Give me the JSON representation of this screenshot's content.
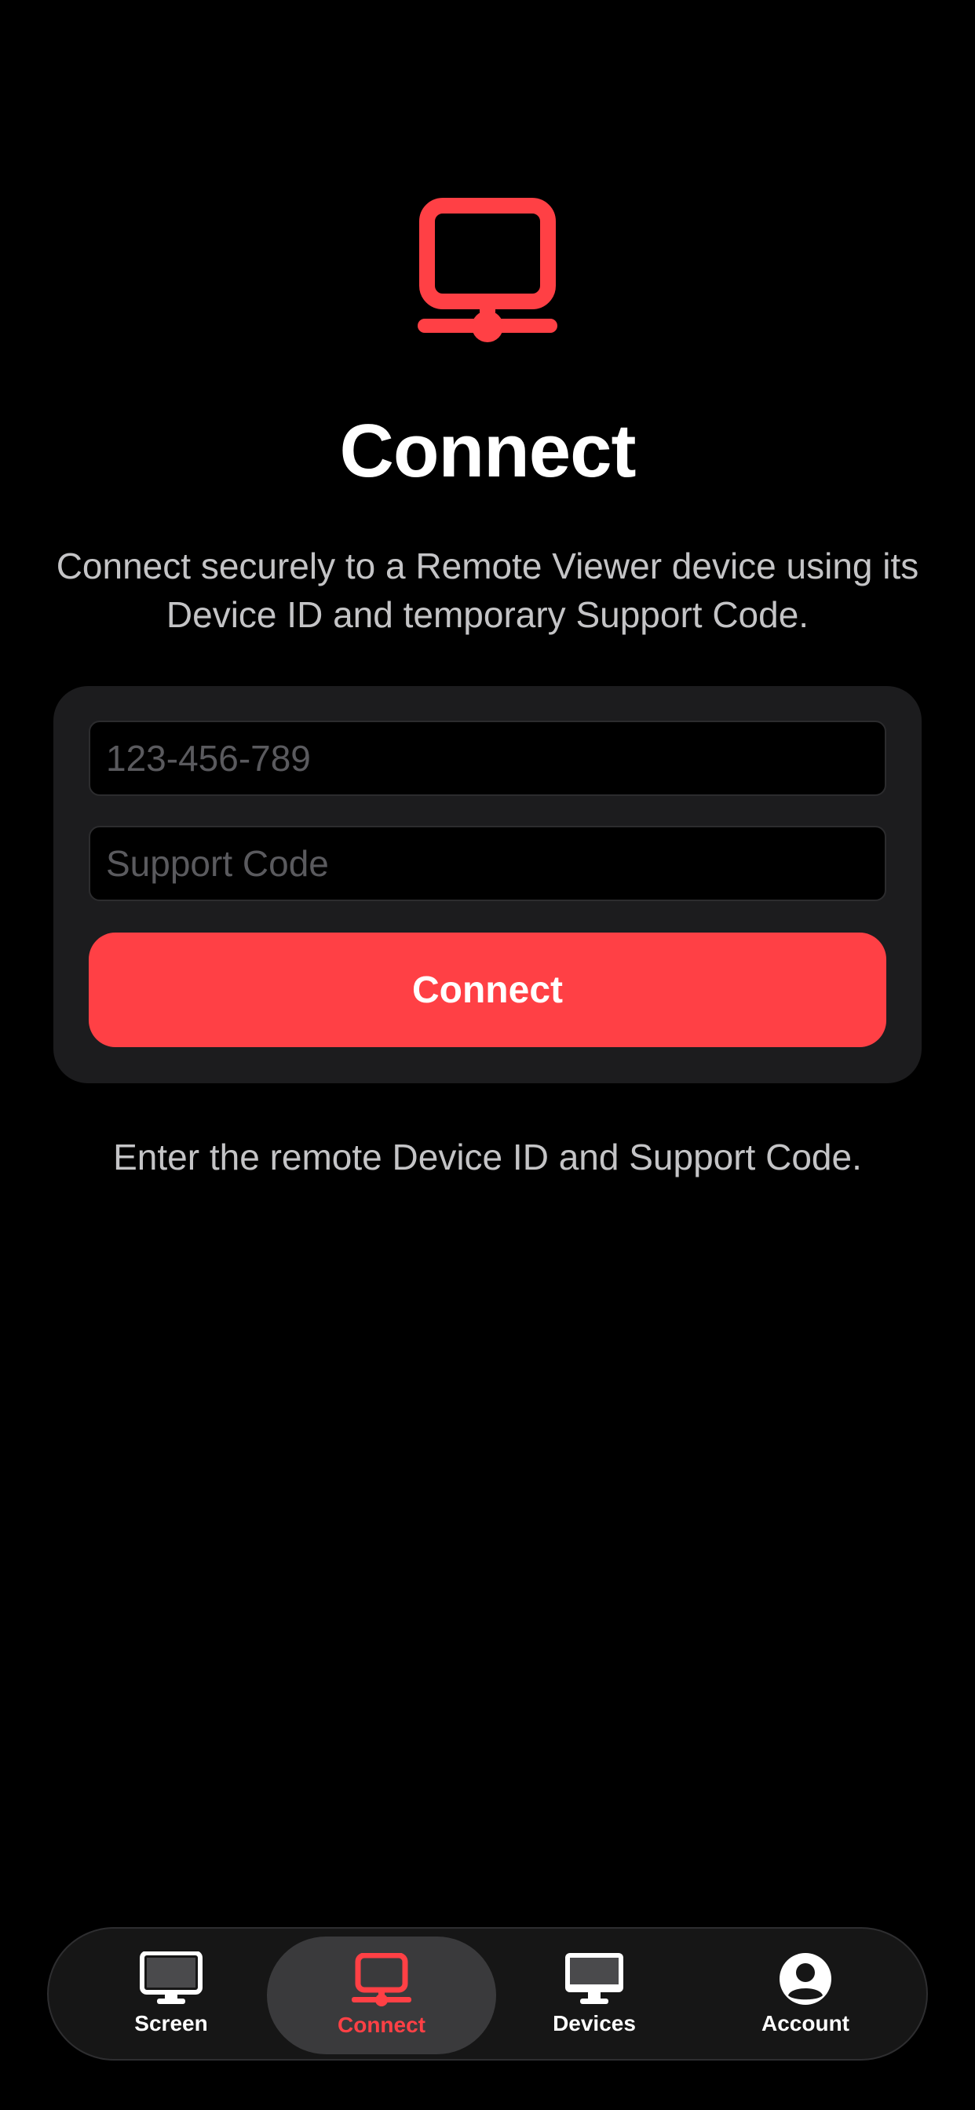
{
  "colors": {
    "accent": "#ff4045",
    "background": "#000000",
    "card": "#1c1c1e",
    "secondary_text": "#c4c4c6",
    "placeholder": "#5a5a5e"
  },
  "hero": {
    "icon": "network-monitor-icon",
    "title": "Connect",
    "subtitle": "Connect securely to a Remote Viewer device using its Device ID and temporary Support Code."
  },
  "form": {
    "device_id_placeholder": "123-456-789",
    "device_id_value": "",
    "support_code_placeholder": "Support Code",
    "support_code_value": "",
    "connect_label": "Connect"
  },
  "status": "Enter the remote Device ID and Support Code.",
  "tabs": [
    {
      "label": "Screen",
      "icon": "monitor-icon",
      "active": false
    },
    {
      "label": "Connect",
      "icon": "network-monitor-icon",
      "active": true
    },
    {
      "label": "Devices",
      "icon": "desktop-icon",
      "active": false
    },
    {
      "label": "Account",
      "icon": "person-circle-icon",
      "active": false
    }
  ]
}
